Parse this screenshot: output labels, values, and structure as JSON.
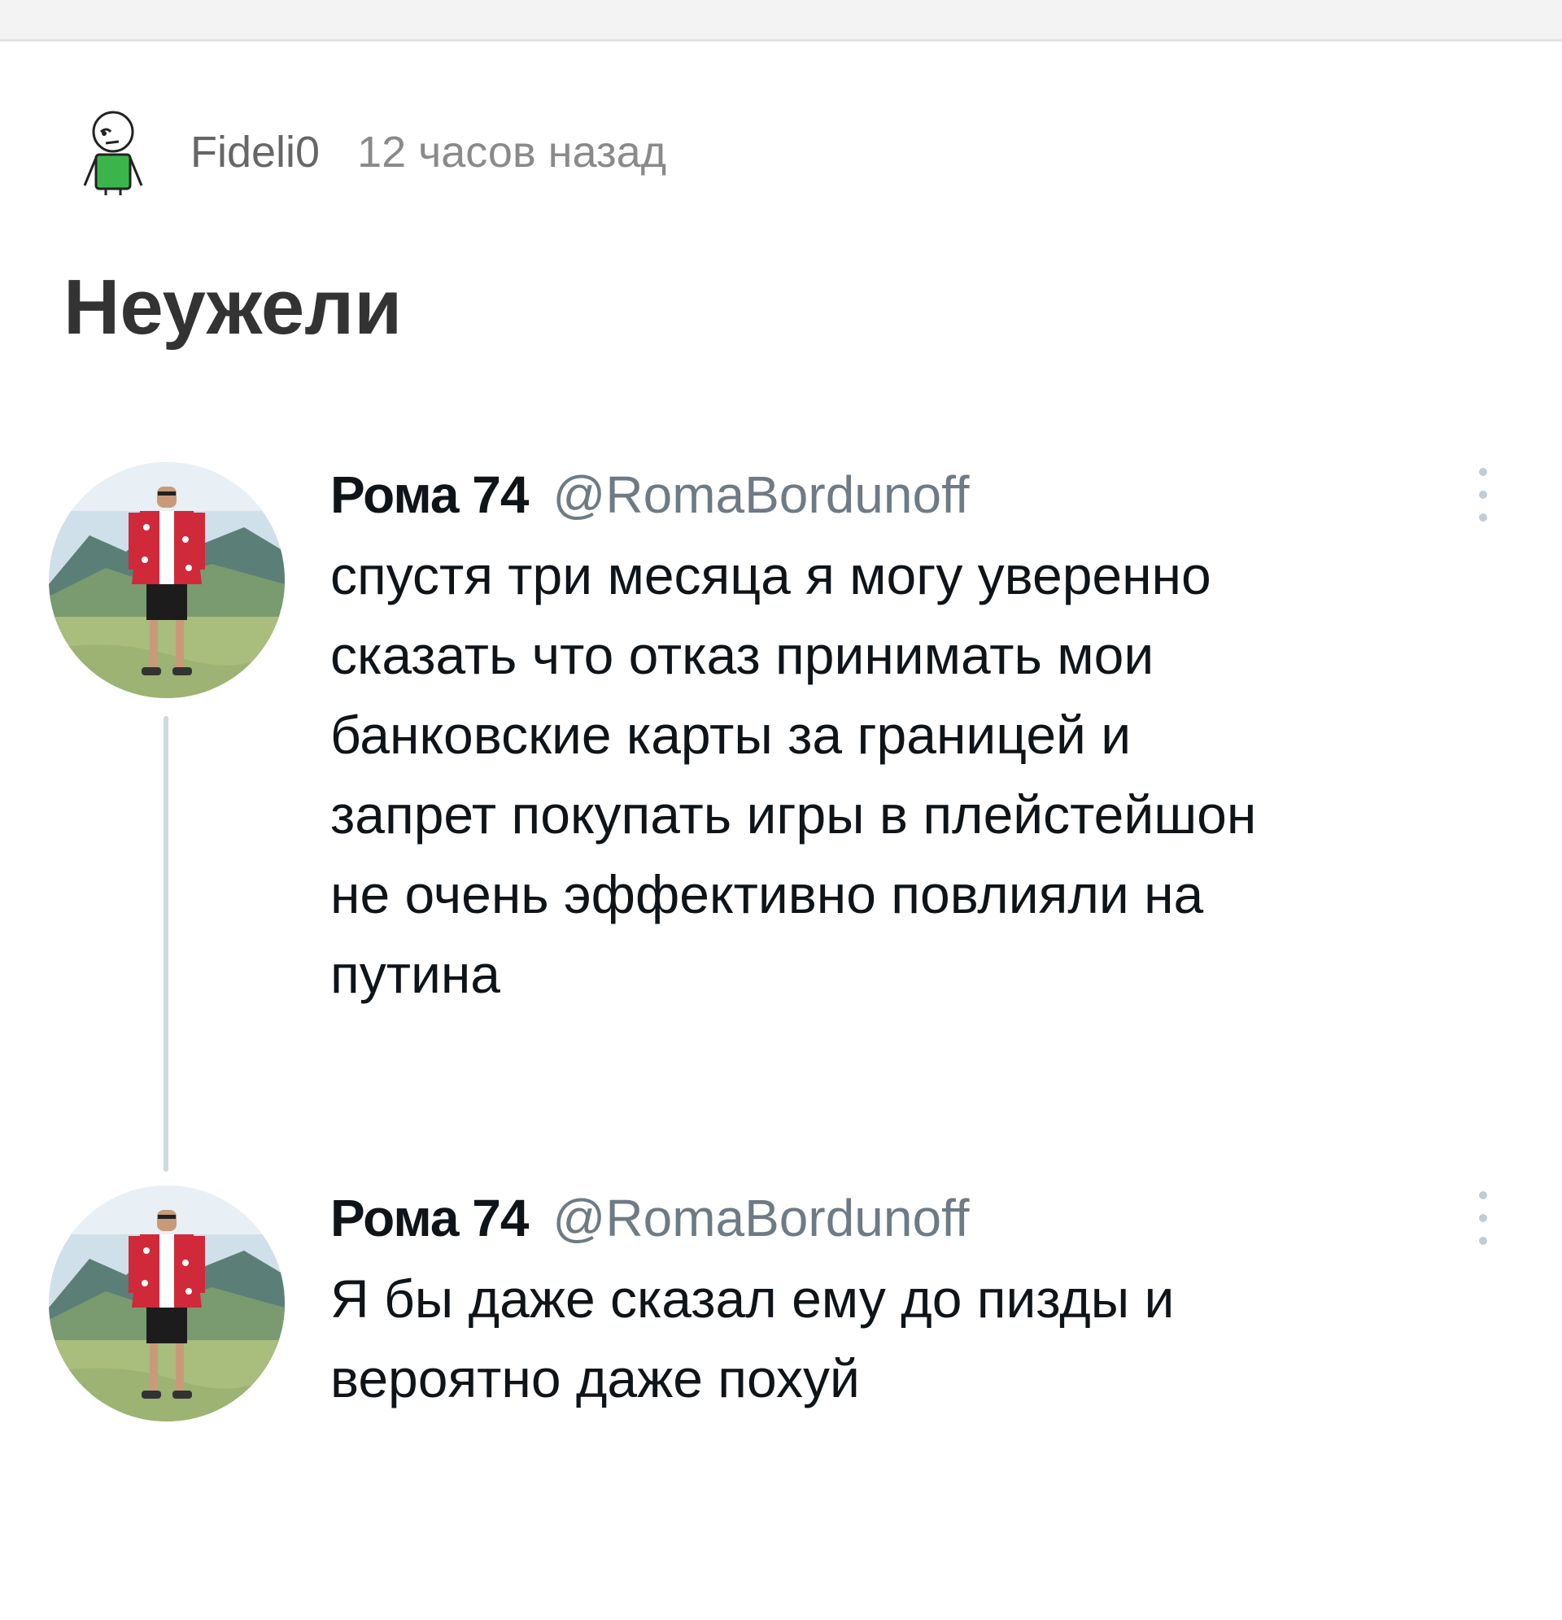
{
  "post": {
    "author": "Fideli0",
    "time": "12 часов назад",
    "title": "Неужели"
  },
  "tweets": [
    {
      "name": "Рома 74",
      "handle": "@RomaBordunoff",
      "lines": [
        "спустя три месяца я могу уверенно",
        "сказать что отказ принимать мои",
        "банковские карты за границей и",
        "запрет покупать игры в плейстейшон",
        "не очень эффективно повлияли на",
        "путина"
      ]
    },
    {
      "name": "Рома 74",
      "handle": "@RomaBordunoff",
      "lines": [
        "Я бы даже сказал ему до пизды и",
        "вероятно даже похуй"
      ]
    }
  ],
  "icons": {
    "author_avatar": "cartoon-person-avatar-icon",
    "tweet_avatar": "person-on-mountain-photo",
    "more": "more-vertical-icon"
  },
  "colors": {
    "avatar_shirt": "#3bb54a",
    "thread_line": "#cfd9de",
    "handle": "#6e7b85"
  }
}
